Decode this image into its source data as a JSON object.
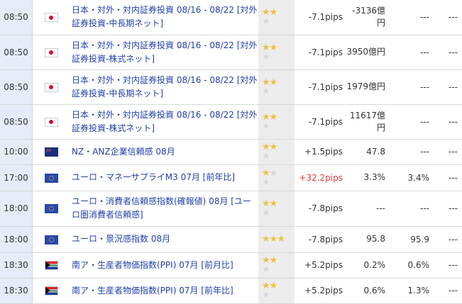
{
  "rows": [
    {
      "time": "08:50",
      "country": "japan",
      "flag_colors": [
        "#ffffff",
        "#d3102e"
      ],
      "title": "日本・対外・対内証券投資 08/16 - 08/22 [対外証券投資-中長期ネット]",
      "stars": 2,
      "change": "-7.1pips",
      "change_up": false,
      "actual": "-3136億円",
      "forecast": "---",
      "previous": "---",
      "height": 49
    },
    {
      "time": "08:50",
      "country": "japan",
      "flag_colors": [
        "#ffffff",
        "#d3102e"
      ],
      "title": "日本・対外・対内証券投資 08/16 - 08/22 [対外証券投資-株式ネット]",
      "stars": 2,
      "change": "-7.1pips",
      "change_up": false,
      "actual": "3950億円",
      "forecast": "---",
      "previous": "---",
      "height": 49
    },
    {
      "time": "08:50",
      "country": "japan",
      "flag_colors": [
        "#ffffff",
        "#d3102e"
      ],
      "title": "日本・対外・対内証券投資 08/16 - 08/22 [対外証券投資-中長期ネット]",
      "stars": 2,
      "change": "-7.1pips",
      "change_up": false,
      "actual": "1979億円",
      "forecast": "---",
      "previous": "---",
      "height": 49
    },
    {
      "time": "08:50",
      "country": "japan",
      "flag_colors": [
        "#ffffff",
        "#d3102e"
      ],
      "title": "日本・対外・対内証券投資 08/16 - 08/22 [対外証券投資-株式ネット]",
      "stars": 2,
      "change": "-7.1pips",
      "change_up": false,
      "actual": "11617億円",
      "forecast": "---",
      "previous": "---",
      "height": 49
    },
    {
      "time": "10:00",
      "country": "new-zealand",
      "flag_colors": [
        "#1a2f7a"
      ],
      "title": "NZ・ANZ企業信頼感 08月",
      "stars": 2,
      "change": "+1.5pips",
      "change_up": false,
      "actual": "47.8",
      "forecast": "---",
      "previous": "---",
      "height": 36
    },
    {
      "time": "17:00",
      "country": "euro",
      "flag_colors": [
        "#2948a8"
      ],
      "title": "ユーロ・マネーサプライM3 07月 [前年比]",
      "stars": 1,
      "change": "+32.2pips",
      "change_up": true,
      "actual": "3.3%",
      "forecast": "3.4%",
      "previous": "---",
      "height": 37
    },
    {
      "time": "18:00",
      "country": "euro",
      "flag_colors": [
        "#2948a8"
      ],
      "title": "ユーロ・消費者信頼感指数(確報値) 08月 [ユーロ圏消費者信頼感]",
      "stars": 2,
      "change": "-7.8pips",
      "change_up": false,
      "actual": "---",
      "forecast": "---",
      "previous": "---",
      "height": 50
    },
    {
      "time": "18:00",
      "country": "euro",
      "flag_colors": [
        "#2948a8"
      ],
      "title": "ユーロ・景況感指数 08月",
      "stars": 3,
      "change": "-7.8pips",
      "change_up": false,
      "actual": "95.8",
      "forecast": "95.9",
      "previous": "---",
      "height": 37
    },
    {
      "time": "18:30",
      "country": "south-africa",
      "flag_colors": [
        "#1f8a4c"
      ],
      "title": "南ア・生産者物価指数(PPI) 07月 [前月比]",
      "stars": 2,
      "change": "+5.2pips",
      "change_up": false,
      "actual": "0.2%",
      "forecast": "0.6%",
      "previous": "---",
      "height": 36
    },
    {
      "time": "18:30",
      "country": "south-africa",
      "flag_colors": [
        "#1f8a4c"
      ],
      "title": "南ア・生産者物価指数(PPI) 07月 [前年比]",
      "stars": 2,
      "change": "+5.2pips",
      "change_up": false,
      "actual": "0.6%",
      "forecast": "1.3%",
      "previous": "---",
      "height": 36
    }
  ],
  "star_colors": {
    "filled": "#e8c33c",
    "empty": "#d2d8e0"
  },
  "link_color": "#1f3fa8",
  "positive_color": "#e83a3a"
}
